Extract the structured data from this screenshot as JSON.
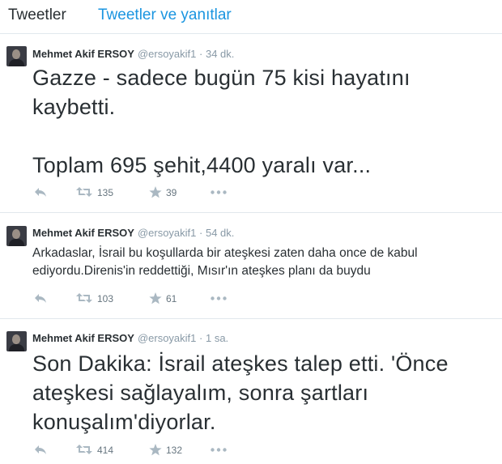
{
  "tabs": {
    "tweets": "Tweetler",
    "tweets_and_replies": "Tweetler ve yanıtlar"
  },
  "tweets": [
    {
      "name": "Mehmet Akif ERSOY",
      "handle": "@ersoyakif1",
      "separator": "·",
      "time": "34 dk.",
      "lines": [
        "Gazze - sadece bugün 75 kisi hayatını",
        "kaybetti.",
        "Toplam 695 şehit,4400 yaralı var..."
      ],
      "retweets": "135",
      "favorites": "39"
    },
    {
      "name": "Mehmet Akif ERSOY",
      "handle": "@ersoyakif1",
      "separator": "·",
      "time": "54 dk.",
      "lines": [
        "Arkadaslar, İsrail bu koşullarda bir ateşkesi zaten daha once de kabul",
        "ediyordu.Direnis'in reddettiği, Mısır'ın ateşkes planı da buydu"
      ],
      "retweets": "103",
      "favorites": "61"
    },
    {
      "name": "Mehmet Akif ERSOY",
      "handle": "@ersoyakif1",
      "separator": "·",
      "time": "1 sa.",
      "lines": [
        "Son Dakika: İsrail ateşkes talep etti. 'Önce",
        "ateşkesi sağlayalım, sonra şartları",
        "konuşalım'diyorlar."
      ],
      "retweets": "414",
      "favorites": "132"
    }
  ],
  "icons": {
    "reply": "reply-icon",
    "retweet": "retweet-icon",
    "favorite": "star-icon",
    "more": "more-icon",
    "avatar": "avatar"
  },
  "colors": {
    "link": "#1b95e0",
    "text": "#292f33",
    "muted": "#8899a6",
    "icon": "#aab8c2",
    "divider": "#e1e8ed"
  }
}
